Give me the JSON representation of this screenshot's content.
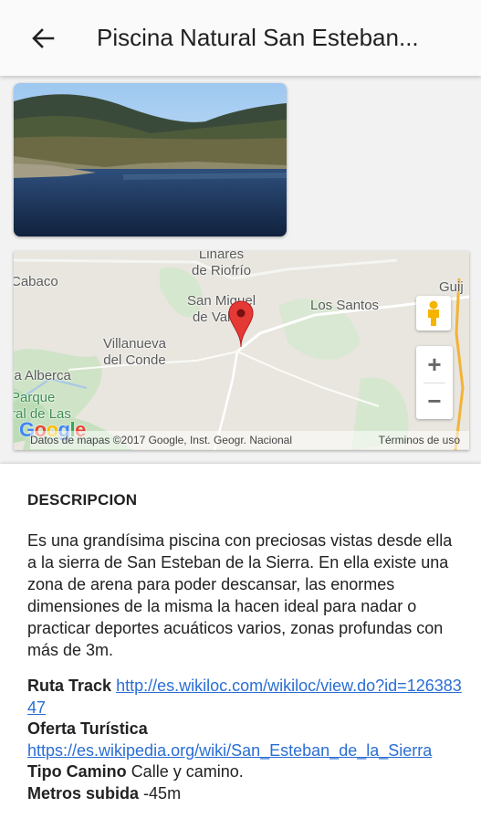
{
  "appbar": {
    "title": "Piscina Natural San Esteban...",
    "back_icon": "arrow-left-icon"
  },
  "photo": {
    "icon": "lake-photo"
  },
  "map": {
    "labels": {
      "linares": "Linares\nde Riofrío",
      "cabaco": "Cabaco",
      "sanmiguel": "San Miguel\nde Valero",
      "santos": "Los Santos",
      "villanueva": "Villanueva\ndel Conde",
      "alberca": "la Alberca",
      "parque": "Parque\nral de Las",
      "guij": "Guij"
    },
    "attribution": "Datos de mapas ©2017 Google, Inst. Geogr. Nacional",
    "terms": "Términos de uso",
    "logo": "Google",
    "zoom_in": "+",
    "zoom_out": "−"
  },
  "content": {
    "heading": "DESCRIPCION",
    "description": "Es una grandísima piscina con preciosas vistas desde ella a la sierra de San Esteban de la Sierra. En ella existe una zona de arena para poder descansar, las enormes dimensiones de la misma la hacen ideal para nadar o practicar deportes acuáticos varios, zonas profundas con más de 3m.",
    "ruta_label": "Ruta Track",
    "ruta_link": "http://es.wikiloc.com/wikiloc/view.do?id=12638347",
    "oferta_label": "Oferta Turística",
    "oferta_link": "https://es.wikipedia.org/wiki/San_Esteban_de_la_Sierra",
    "camino_label": "Tipo Camino",
    "camino_value": "Calle y camino.",
    "metros_label": "Metros subida",
    "metros_value": "-45m"
  }
}
